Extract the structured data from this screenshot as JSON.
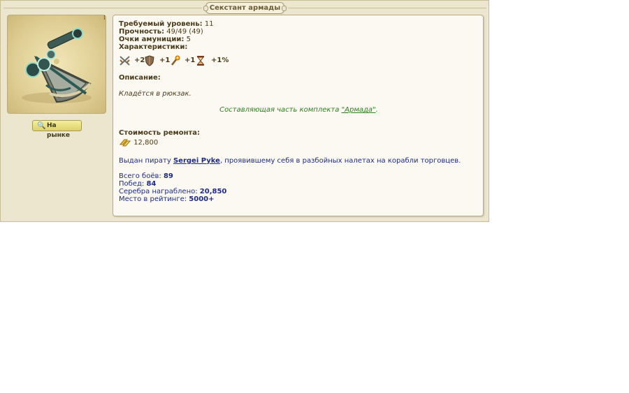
{
  "window": {
    "title": "Секстант армады"
  },
  "actions": {
    "market_label": "На рынке"
  },
  "item": {
    "req_level_label": "Требуемый уровень:",
    "req_level_value": "11",
    "durability_label": "Прочность:",
    "durability_value": "49/49",
    "durability_max": "(49)",
    "ammo_label": "Очки амуниции:",
    "ammo_value": "5",
    "stats_label": "Характеристики:",
    "stats": [
      {
        "icon": "crossed-swords-icon",
        "value": "+2"
      },
      {
        "icon": "shield-icon",
        "value": "+1"
      },
      {
        "icon": "torch-icon",
        "value": "+1"
      },
      {
        "icon": "hourglass-icon",
        "value": "+1%"
      }
    ],
    "description_label": "Описание:",
    "description_text": "Кладётся в рюкзак.",
    "set_text_prefix": "Составляющая часть комплекта",
    "set_link": "\"Армада\"",
    "set_text_suffix": ".",
    "repair_label": "Стоимость ремонта:",
    "repair_value": "12,800"
  },
  "issued": {
    "prefix": "Выдан пирату",
    "player": "Sergei Pyke",
    "suffix": ", проявившему себя в разбойных налетах на корабли торговцев."
  },
  "stats_summary": {
    "battles_label": "Всего боёв:",
    "battles_value": "89",
    "wins_label": "Побед:",
    "wins_value": "84",
    "silver_label": "Серебра награблено:",
    "silver_value": "20,850",
    "rank_label": "Место в рейтинге:",
    "rank_value": "5000+"
  },
  "colors": {
    "set_green": "#2e7d21",
    "stat_blue": "#1e2a8a",
    "panel_bg": "#ece6cf"
  }
}
